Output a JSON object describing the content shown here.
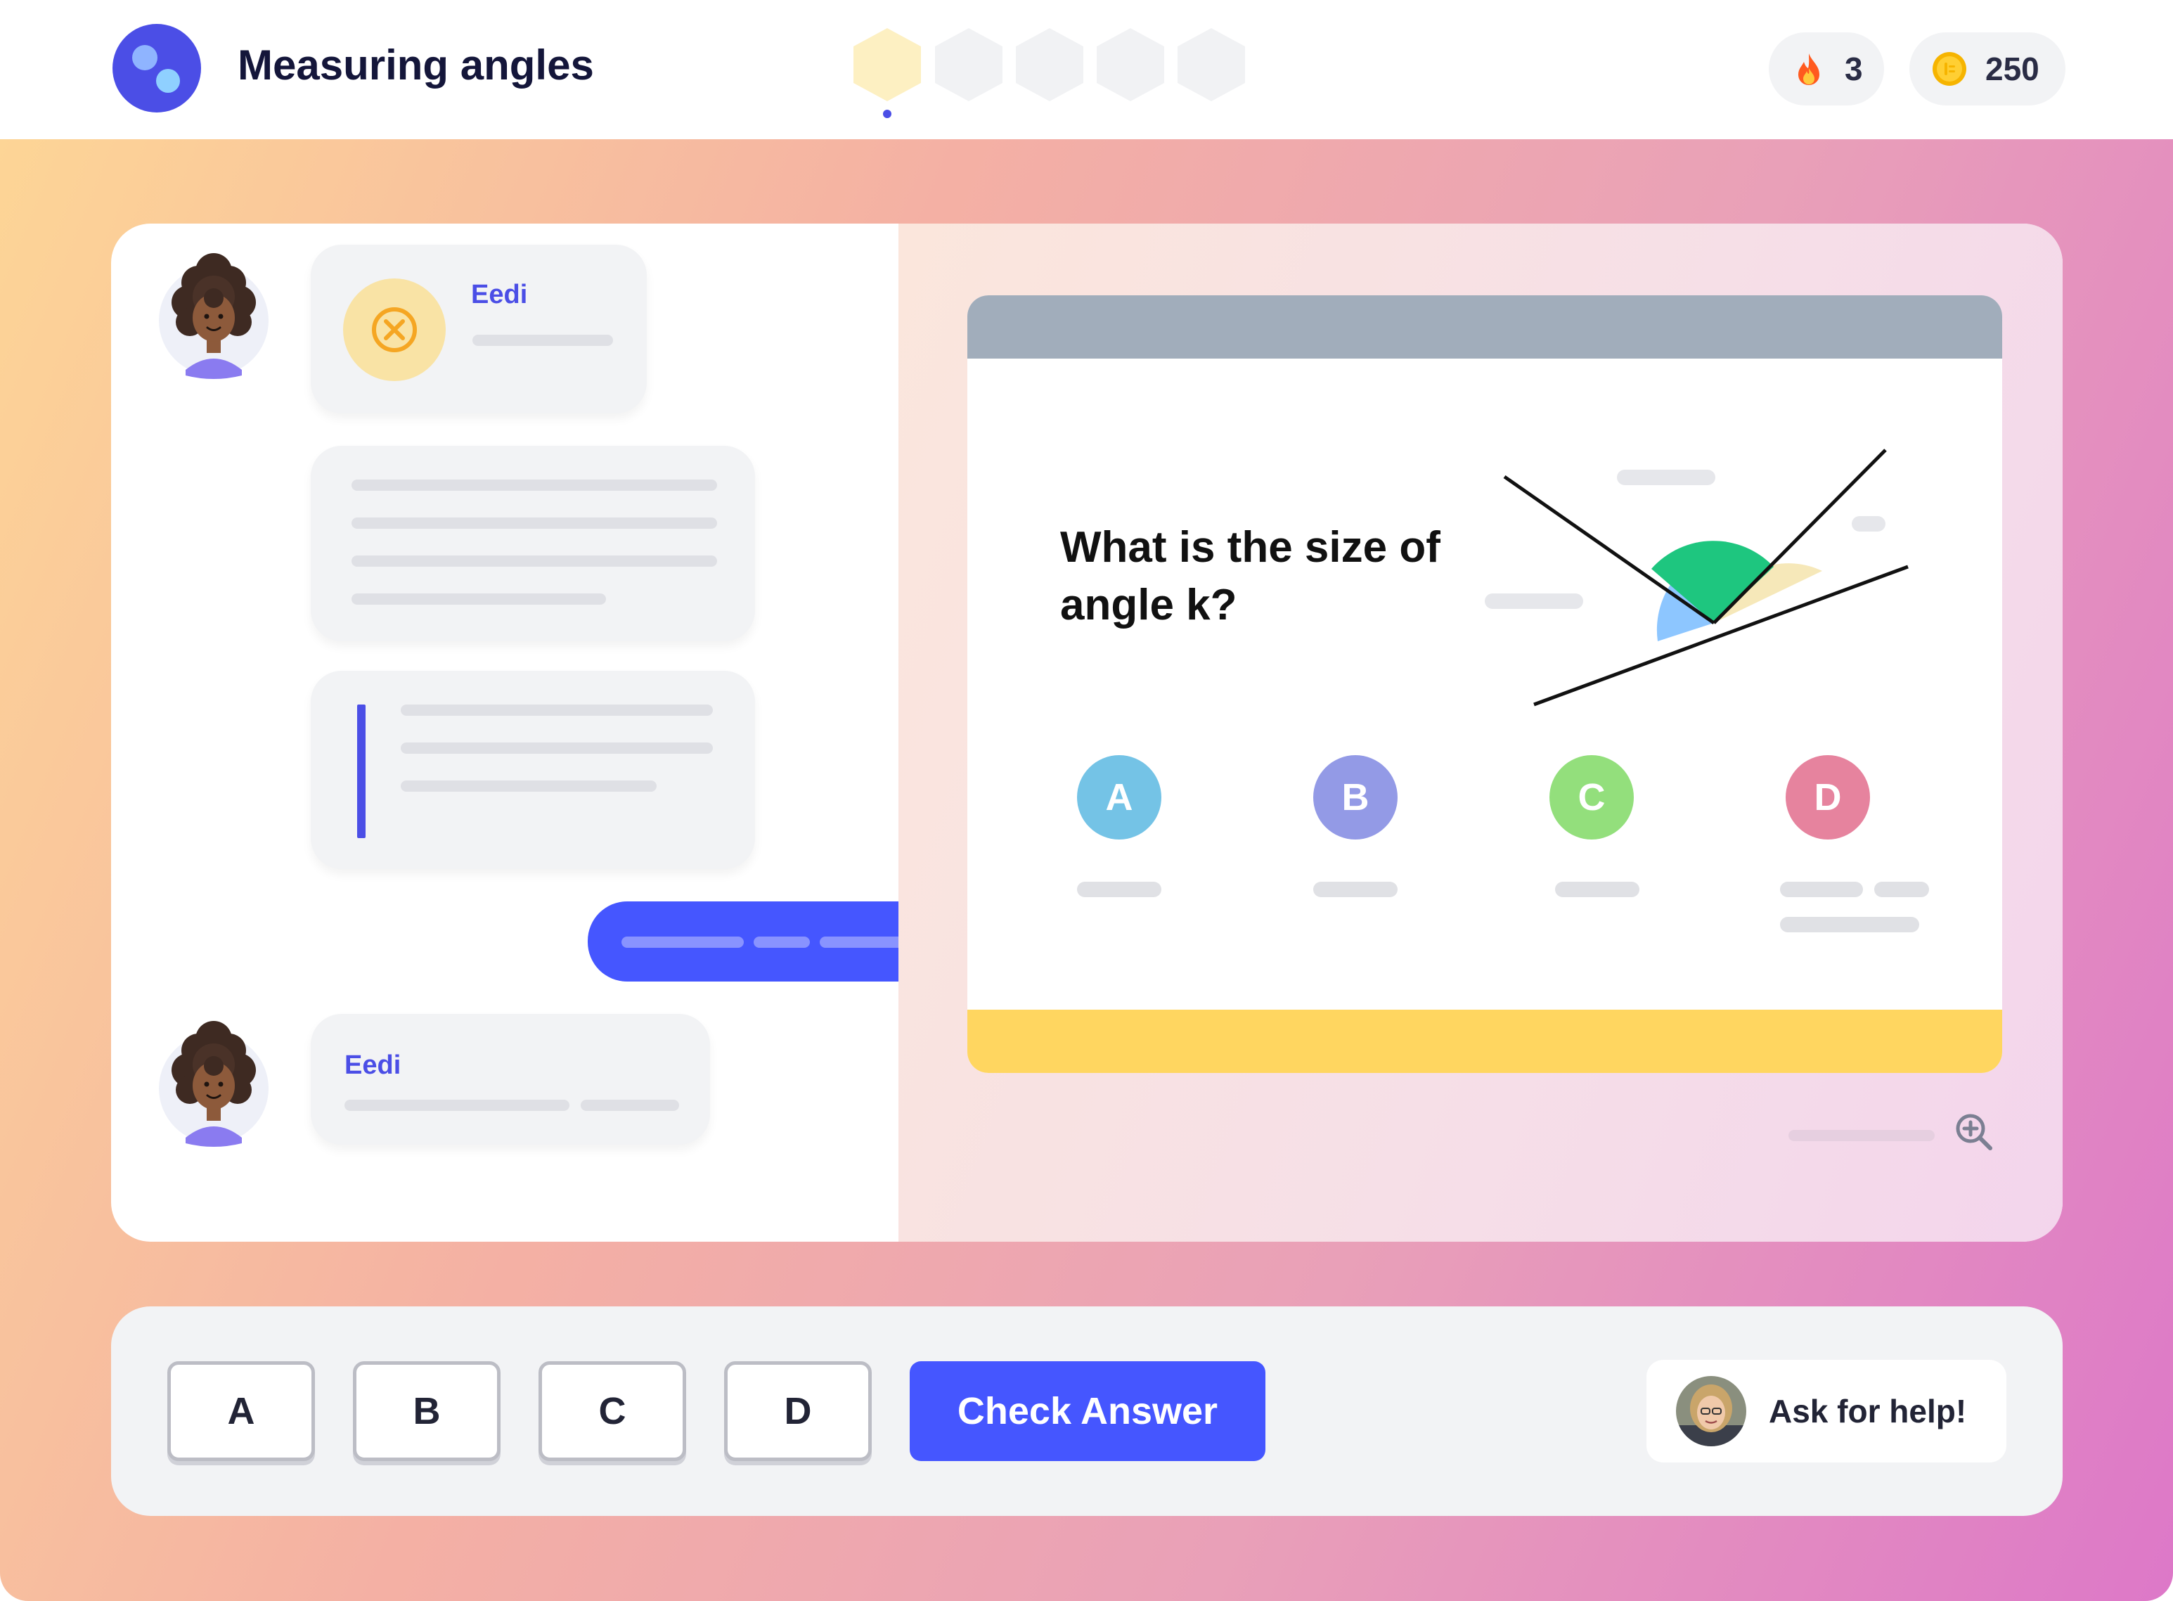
{
  "header": {
    "title": "Measuring angles",
    "progress": {
      "total_steps": 5,
      "current_step": 1
    },
    "streak": {
      "icon": "fire-icon",
      "value": "3"
    },
    "coins": {
      "icon": "coin-icon",
      "value": "250"
    }
  },
  "chat": {
    "bot_name": "Eedi",
    "messages": [
      {
        "from": "bot",
        "name": "Eedi",
        "icon": "incorrect-x-icon"
      },
      {
        "from": "bot",
        "kind": "explanation"
      },
      {
        "from": "bot",
        "kind": "quote"
      },
      {
        "from": "user"
      },
      {
        "from": "bot",
        "name": "Eedi"
      }
    ]
  },
  "question": {
    "text": "What is the size of angle k?",
    "options": [
      {
        "letter": "A",
        "color": "#74c3e6"
      },
      {
        "letter": "B",
        "color": "#939ae6"
      },
      {
        "letter": "C",
        "color": "#93df7c"
      },
      {
        "letter": "D",
        "color": "#e6839e"
      }
    ],
    "diagram_colors": {
      "green_angle": "#1ec67f",
      "blue_angle": "#8dc6ff",
      "yellow_angle": "#f6e8b9"
    }
  },
  "answer_bar": {
    "choices": [
      "A",
      "B",
      "C",
      "D"
    ],
    "check_label": "Check Answer",
    "help_label": "Ask for help!"
  },
  "colors": {
    "brand": "#4b4ee6",
    "button_blue": "#4556ff",
    "header_grey": "#a1adbb",
    "footer_yellow": "#ffd660"
  }
}
